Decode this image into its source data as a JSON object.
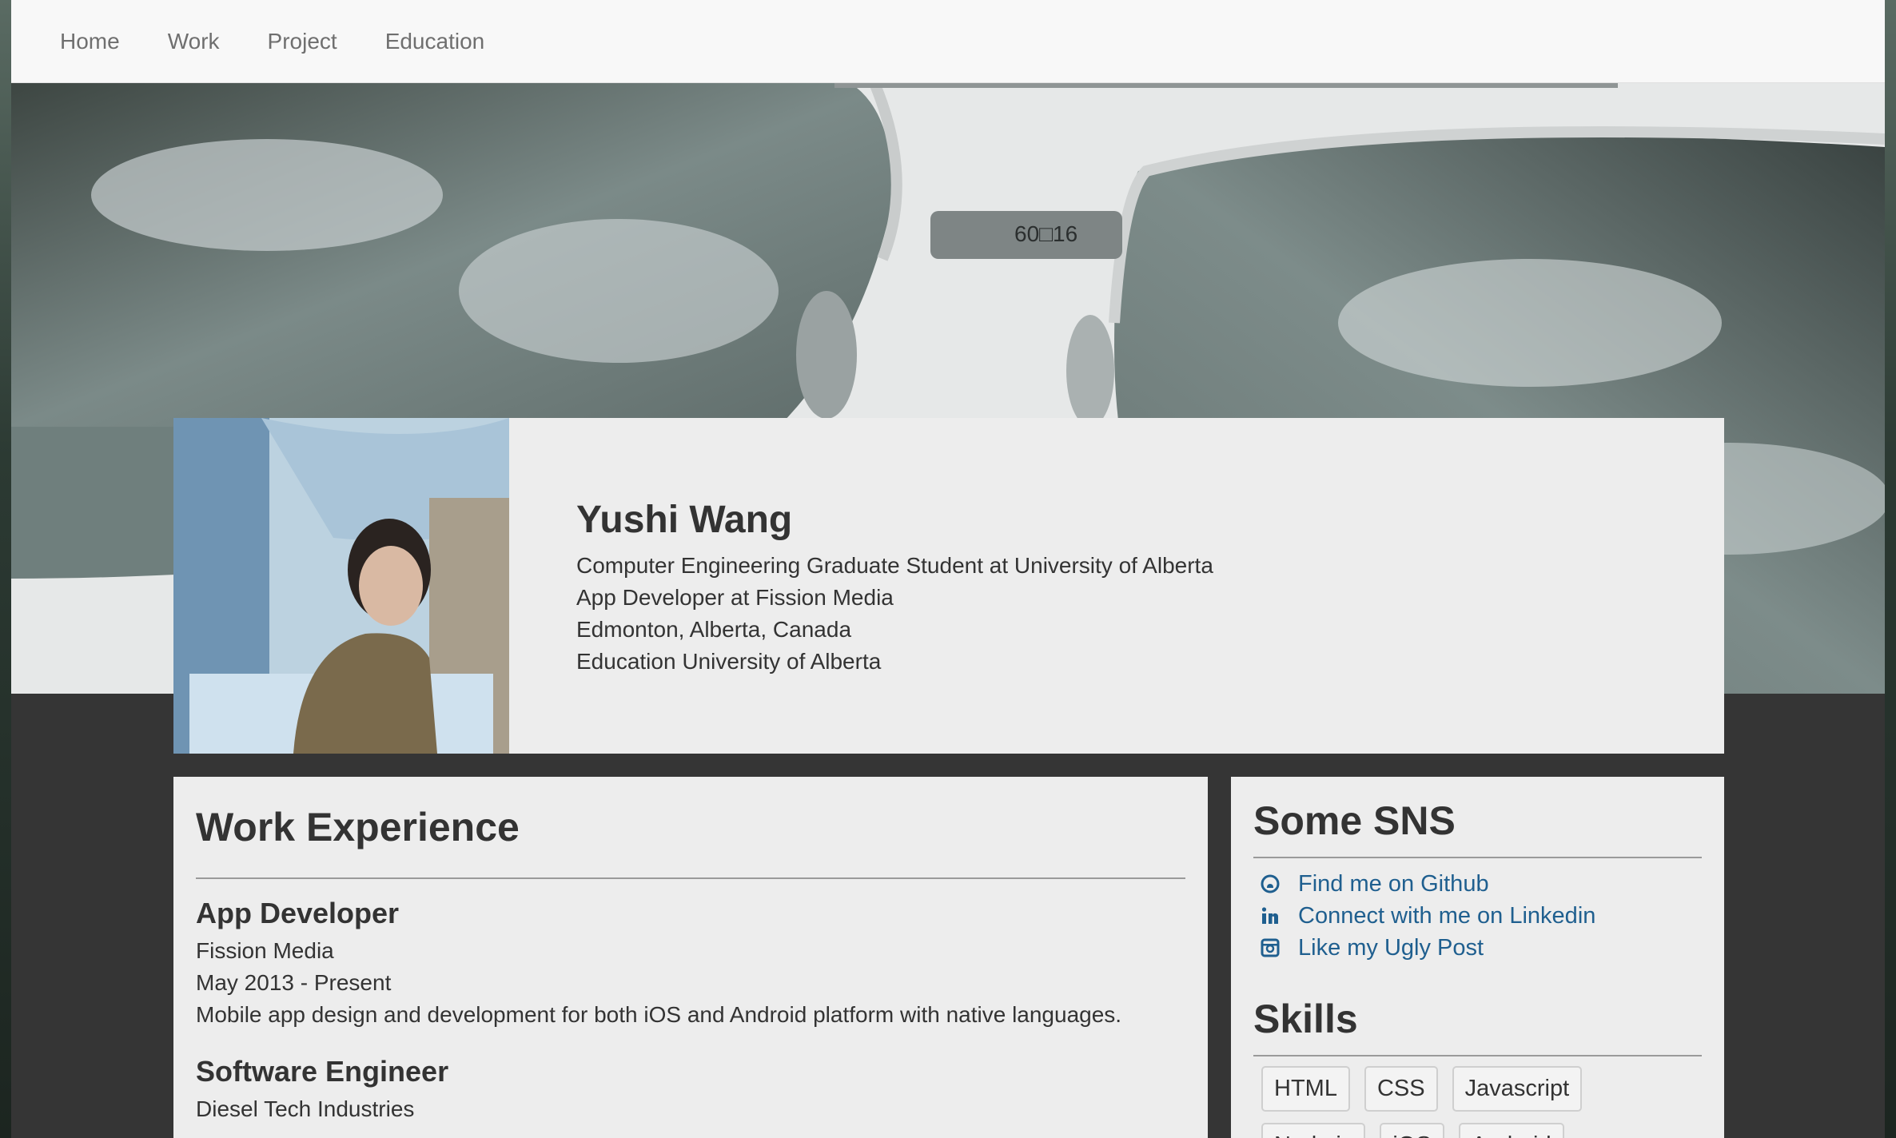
{
  "nav": {
    "items": [
      "Home",
      "Work",
      "Project",
      "Education"
    ]
  },
  "hero": {
    "lens_mark": "60□16"
  },
  "profile": {
    "name": "Yushi Wang",
    "lines": [
      "Computer Engineering Graduate Student at University of Alberta",
      "App Developer at Fission Media",
      "Edmonton, Alberta, Canada",
      "Education University of Alberta"
    ]
  },
  "work": {
    "title": "Work Experience",
    "jobs": [
      {
        "title": "App Developer",
        "company": "Fission Media",
        "period": "May 2013 - Present",
        "description": "Mobile app design and development for both iOS and Android platform with native languages."
      },
      {
        "title": "Software Engineer",
        "company": "Diesel Tech Industries"
      }
    ]
  },
  "sns": {
    "title": "Some SNS",
    "items": [
      {
        "label": "Find me on Github",
        "icon": "github-icon"
      },
      {
        "label": "Connect with me on Linkedin",
        "icon": "linkedin-icon"
      },
      {
        "label": "Like my Ugly Post",
        "icon": "instagram-icon"
      }
    ]
  },
  "skills": {
    "title": "Skills",
    "items": [
      "HTML",
      "CSS",
      "Javascript",
      "Node.js",
      "iOS",
      "Android"
    ]
  },
  "colors": {
    "link": "#1f5f8f",
    "card_bg": "#ededed",
    "page_bg": "#353535",
    "nav_bg": "#f8f8f8"
  }
}
